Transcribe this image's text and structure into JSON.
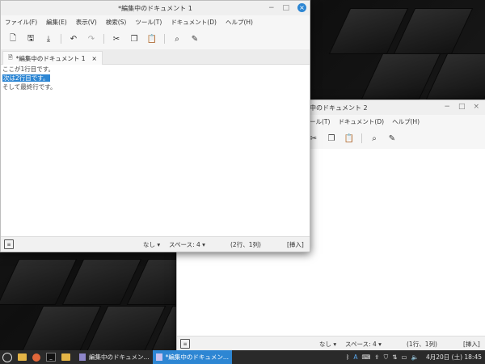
{
  "window1": {
    "title": "*編集中のドキュメント 1",
    "menu": [
      "ファイル(F)",
      "編集(E)",
      "表示(V)",
      "検索(S)",
      "ツール(T)",
      "ドキュメント(D)",
      "ヘルプ(H)"
    ],
    "tab_label": "*編集中のドキュメント 1",
    "lines": [
      "ここが1行目です。",
      "次は2行目です。",
      "そして最終行です。"
    ],
    "selected_line_index": 1,
    "status": {
      "encoding": "なし",
      "spaces": "スペース: 4",
      "position": "(2行、1列)",
      "mode": "[挿入]"
    }
  },
  "window2": {
    "title": "中のドキュメント 2",
    "menu": [
      "ール(T)",
      "ドキュメント(D)",
      "ヘルプ(H)"
    ],
    "status": {
      "encoding": "なし",
      "spaces": "スペース: 4",
      "position": "(1行、1列)",
      "mode": "[挿入]"
    }
  },
  "taskbar": {
    "tasks": [
      "編集中のドキュメン...",
      "*編集中のドキュメン..."
    ],
    "active_task_index": 1,
    "clock": "4月20日 (土) 18:45",
    "input_method": "A"
  },
  "icons": {
    "close": "×",
    "minimize": "−",
    "maximize": "□"
  },
  "colors": {
    "accent": "#2d86d3",
    "taskbar": "#2a2a2a"
  }
}
